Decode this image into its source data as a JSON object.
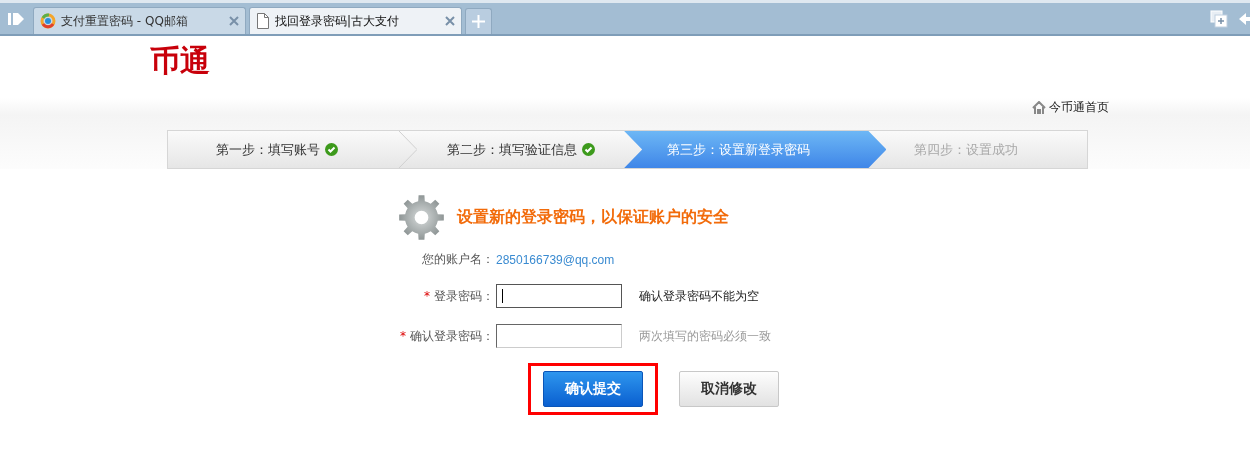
{
  "browser": {
    "tabs": [
      {
        "title": "支付重置密码 - QQ邮箱",
        "selected": false
      },
      {
        "title": "找回登录密码|古大支付",
        "selected": true
      }
    ]
  },
  "logo": {
    "text": "币通"
  },
  "home_link": "今币通首页",
  "steps": [
    {
      "label": "第一步：填写账号",
      "completed": true,
      "selected": false
    },
    {
      "label": "第二步：填写验证信息",
      "completed": true,
      "selected": false
    },
    {
      "label": "第三步：设置新登录密码",
      "completed": false,
      "selected": true
    },
    {
      "label": "第四步：设置成功",
      "completed": false,
      "selected": false
    }
  ],
  "form": {
    "heading": "设置新的登录密码，以保证账户的安全",
    "account_label": "您的账户名：",
    "account_value": "2850166739@qq.com",
    "fields": [
      {
        "marker": "*",
        "label": "登录密码：",
        "focused": true,
        "message": "确认登录密码不能为空",
        "kind": "error"
      },
      {
        "marker": "*",
        "label": "确认登录密码：",
        "focused": false,
        "message": "两次填写的密码必须一致",
        "kind": "hint"
      }
    ],
    "buttons": [
      {
        "label": "确认提交",
        "kind": "primary",
        "highlighted": true
      },
      {
        "label": "取消修改",
        "kind": "secondary",
        "highlighted": false
      }
    ]
  }
}
